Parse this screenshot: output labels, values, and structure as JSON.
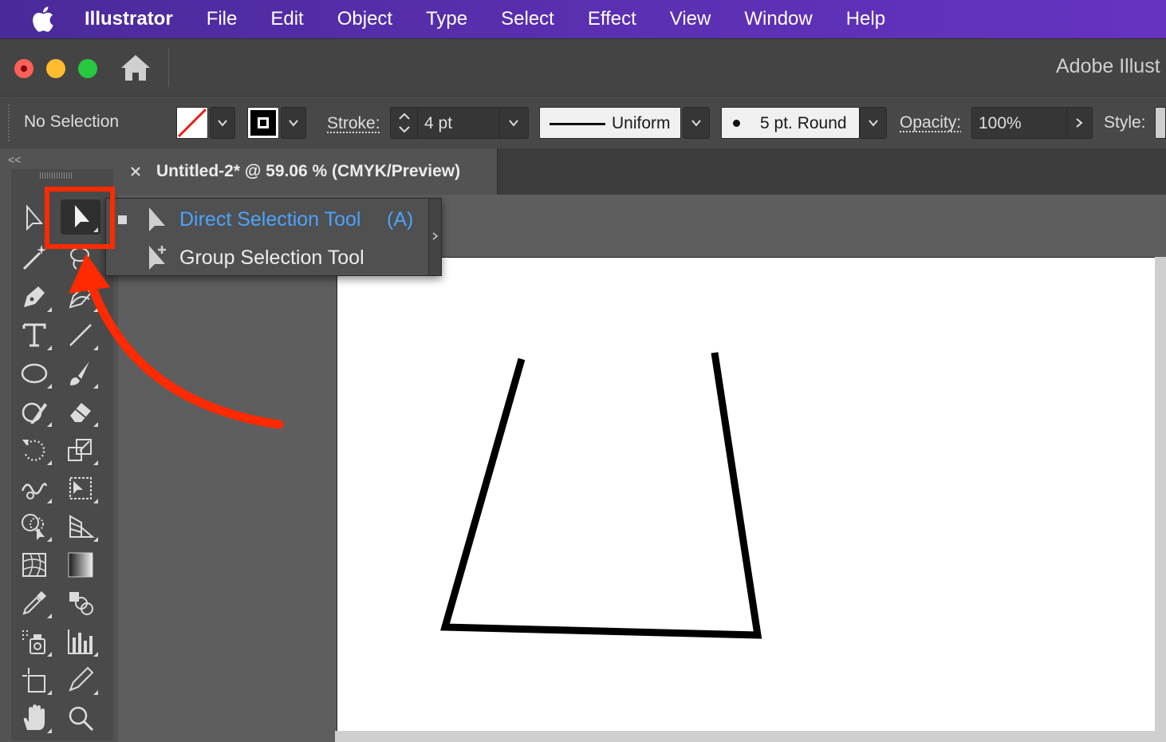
{
  "menubar": {
    "app_name": "Illustrator",
    "items": [
      "File",
      "Edit",
      "Object",
      "Type",
      "Select",
      "Effect",
      "View",
      "Window",
      "Help"
    ]
  },
  "titlebar": {
    "title": "Adobe Illust"
  },
  "controlbar": {
    "selection_status": "No Selection",
    "stroke_label": "Stroke:",
    "stroke_weight": "4 pt",
    "variable_width_profile": "Uniform",
    "brush_definition": "5 pt. Round",
    "opacity_label": "Opacity:",
    "opacity_value": "100%",
    "style_label": "Style:"
  },
  "toolspanel": {
    "collapse_label": "<<"
  },
  "document": {
    "tab_title": "Untitled-2* @ 59.06 % (CMYK/Preview)"
  },
  "flyout": {
    "items": [
      {
        "label": "Direct Selection Tool",
        "shortcut": "(A)",
        "selected": true
      },
      {
        "label": "Group Selection Tool",
        "shortcut": "",
        "selected": false
      }
    ]
  },
  "colors": {
    "menubar": "#5a2fb0",
    "highlight": "#ff2a00",
    "selected_text": "#4aa3ff"
  }
}
